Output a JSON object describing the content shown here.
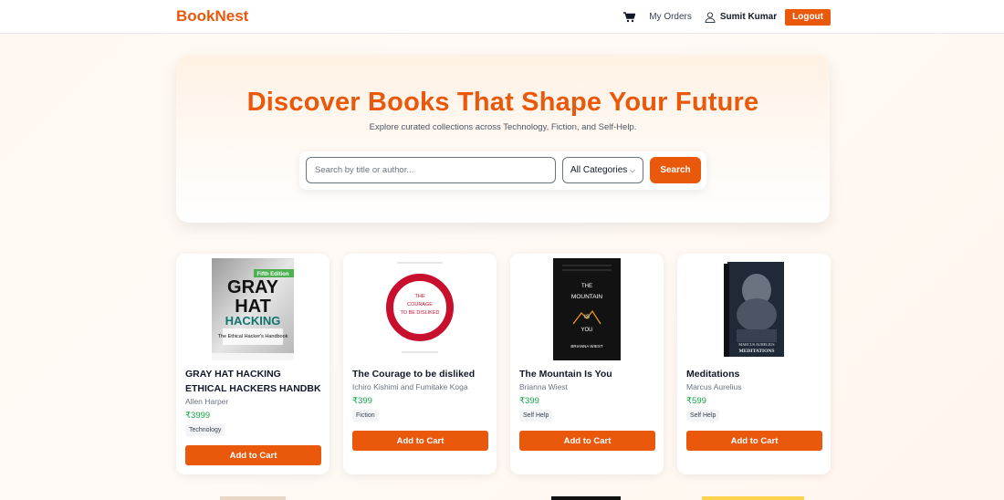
{
  "navbar": {
    "brand": "BookNest",
    "cart_icon": "cart-icon",
    "orders_label": "My Orders",
    "user_icon": "user-icon",
    "user_name": "Sumit Kumar",
    "logout_label": "Logout"
  },
  "hero": {
    "title": "Discover Books That Shape Your Future",
    "subtitle": "Explore curated collections across Technology, Fiction, and Self-Help.",
    "search_placeholder": "Search by title or author...",
    "category_selected": "All Categories",
    "search_label": "Search"
  },
  "colors": {
    "accent": "#ea580c",
    "price": "#16a34a"
  },
  "books": [
    {
      "title": "GRAY HAT HACKING ETHICAL HACKERS HANDBK",
      "author": "Allen Harper",
      "price": "₹3999",
      "category": "Technology",
      "button": "Add to Cart",
      "cover": {
        "line1": "GRAY",
        "line2": "HAT",
        "line3": "HACKING",
        "subtitle": "The Ethical Hacker's Handbook",
        "badge": "Fifth Edition"
      }
    },
    {
      "title": "The Courage to be disliked",
      "author": "Ichiro Kishimi and Fumitake Koga",
      "price": "₹399",
      "category": "Fiction",
      "button": "Add to Cart",
      "cover": {
        "line1": "THE",
        "line2": "COURAGE",
        "line3": "TO BE DISLIKED",
        "subtitle": "",
        "badge": ""
      }
    },
    {
      "title": "The Mountain Is You",
      "author": "Brianna Wiest",
      "price": "₹399",
      "category": "Self Help",
      "button": "Add to Cart",
      "cover": {
        "line1": "THE",
        "line2": "MOUNTAIN",
        "line3": "IS",
        "line4": "YOU",
        "subtitle": "BRIANNA WIEST",
        "badge": ""
      }
    },
    {
      "title": "Meditations",
      "author": "Marcus Aurelius",
      "price": "₹599",
      "category": "Self Help",
      "button": "Add to Cart",
      "cover": {
        "line1": "MARCUS AURELIUS",
        "line2": "MEDITATIONS",
        "subtitle": "",
        "badge": ""
      }
    }
  ]
}
